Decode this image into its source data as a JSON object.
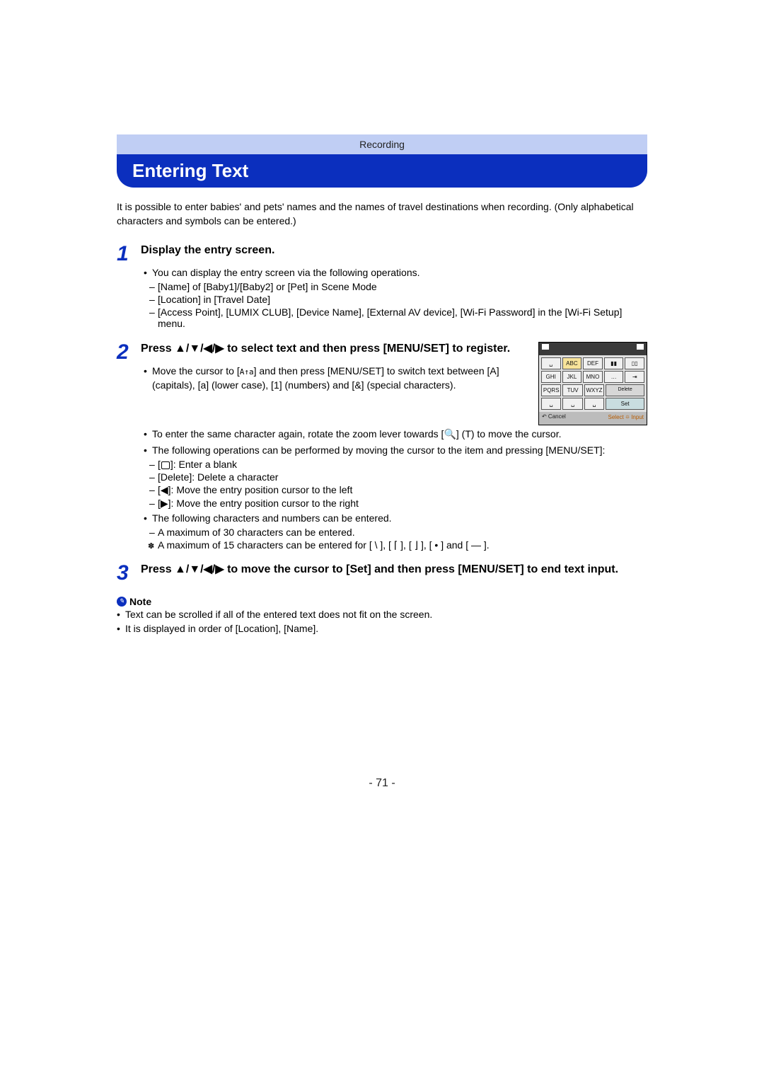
{
  "category": "Recording",
  "title": "Entering Text",
  "intro": "It is possible to enter babies' and pets' names and the names of travel destinations when recording. (Only alphabetical characters and symbols can be entered.)",
  "steps": {
    "s1": {
      "num": "1",
      "heading": "Display the entry screen.",
      "b1": "You can display the entry screen via the following operations.",
      "b1a": "[Name] of [Baby1]/[Baby2] or [Pet] in Scene Mode",
      "b1b": "[Location] in [Travel Date]",
      "b1c": "[Access Point], [LUMIX CLUB], [Device Name], [External AV device], [Wi-Fi Password] in the [Wi-Fi Setup] menu."
    },
    "s2": {
      "num": "2",
      "heading": "Press ▲/▼/◀/▶ to select text and then press [MENU/SET] to register.",
      "b1_pre": "Move the cursor to [",
      "b1_post": "] and then press [MENU/SET] to switch text between [A] (capitals), [a] (lower case), [1] (numbers) and [&] (special characters).",
      "switch_icon": "A↑a",
      "b2_pre": "To enter the same character again, rotate the zoom lever towards [",
      "b2_mid": "🔍",
      "b2_post": "] (T) to move the cursor.",
      "b3": "The following operations can be performed by moving the cursor to the item and pressing [MENU/SET]:",
      "b3a_pre": "[",
      "b3a_post": "]: Enter a blank",
      "b3b": "[Delete]: Delete a character",
      "b3c": "[◀]: Move the entry position cursor to the left",
      "b3d": "[▶]: Move the entry position cursor to the right",
      "b4": "The following characters and numbers can be entered.",
      "b4a": "A maximum of 30 characters can be entered.",
      "b4a_star": "A maximum of 15 characters can be entered for [ \\ ], [ ⌈ ], [ ⌋ ], [ • ] and [ — ]."
    },
    "s3": {
      "num": "3",
      "heading": "Press ▲/▼/◀/▶ to move the cursor to [Set] and then press [MENU/SET] to end text input."
    }
  },
  "keyboard": {
    "r1": [
      "␣",
      "ABC",
      "DEF",
      "▮▮",
      "▯▯"
    ],
    "r2": [
      "GHI",
      "JKL",
      "MNO",
      "…",
      "⇥"
    ],
    "r3": [
      "PQRS",
      "TUV",
      "WXYZ",
      "Delete"
    ],
    "r4": [
      "␣",
      "␣",
      "␣",
      "Set"
    ],
    "bottom_left": "↶ Cancel",
    "bottom_right": "Select ⯐ Input"
  },
  "note": {
    "label": "Note",
    "n1": "Text can be scrolled if all of the entered text does not fit on the screen.",
    "n2": "It is displayed in order of [Location], [Name]."
  },
  "page_number": "- 71 -"
}
